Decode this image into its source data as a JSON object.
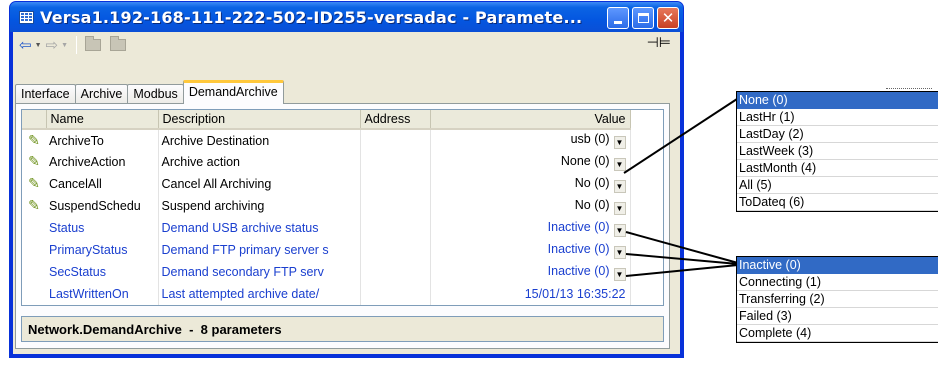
{
  "window": {
    "title": "Versa1.192-168-111-222-502-ID255-versadac - Paramete..."
  },
  "toolbar": {
    "back_icon": "back-arrow-icon",
    "forward_icon": "forward-arrow-icon",
    "folder_icon": "folder-icon",
    "pin_icon": "pin-icon"
  },
  "tabs": [
    "Interface",
    "Archive",
    "Modbus",
    "DemandArchive"
  ],
  "active_tab": "DemandArchive",
  "table": {
    "columns": [
      "Name",
      "Description",
      "Address",
      "Value"
    ],
    "rows": [
      {
        "editable": true,
        "name": "ArchiveTo",
        "description": "Archive Destination",
        "address": "",
        "value": "usb (0)",
        "dropdown": true
      },
      {
        "editable": true,
        "name": "ArchiveAction",
        "description": "Archive action",
        "address": "",
        "value": "None (0)",
        "dropdown": true
      },
      {
        "editable": true,
        "name": "CancelAll",
        "description": "Cancel All Archiving",
        "address": "",
        "value": "No (0)",
        "dropdown": true
      },
      {
        "editable": true,
        "name": "SuspendSchedu",
        "description": "Suspend archiving",
        "address": "",
        "value": "No (0)",
        "dropdown": true
      },
      {
        "editable": false,
        "name": "Status",
        "description": "Demand USB archive status",
        "address": "",
        "value": "Inactive (0)",
        "dropdown": true
      },
      {
        "editable": false,
        "name": "PrimaryStatus",
        "description": "Demand FTP primary server s",
        "address": "",
        "value": "Inactive (0)",
        "dropdown": true
      },
      {
        "editable": false,
        "name": "SecStatus",
        "description": "Demand secondary FTP serv",
        "address": "",
        "value": "Inactive (0)",
        "dropdown": true
      },
      {
        "editable": false,
        "name": "LastWrittenOn",
        "description": "Last attempted archive date/",
        "address": "",
        "value": "15/01/13 16:35:22",
        "dropdown": false
      }
    ]
  },
  "status_bar": {
    "text": "Network.DemandArchive  -  8 parameters"
  },
  "archive_action_options": {
    "options": [
      "None (0)",
      "LastHr (1)",
      "LastDay (2)",
      "LastWeek (3)",
      "LastMonth (4)",
      "All (5)",
      "ToDateq (6)"
    ],
    "selected": "None (0)"
  },
  "status_options": {
    "options": [
      "Inactive (0)",
      "Connecting (1)",
      "Transferring (2)",
      "Failed (3)",
      "Complete (4)"
    ],
    "selected": "Inactive (0)"
  },
  "colors": {
    "title_bar": "#0456e0",
    "readonly_text": "#1a3fcf",
    "selection": "#316ac5",
    "active_tab_accent": "#ffc83c"
  }
}
